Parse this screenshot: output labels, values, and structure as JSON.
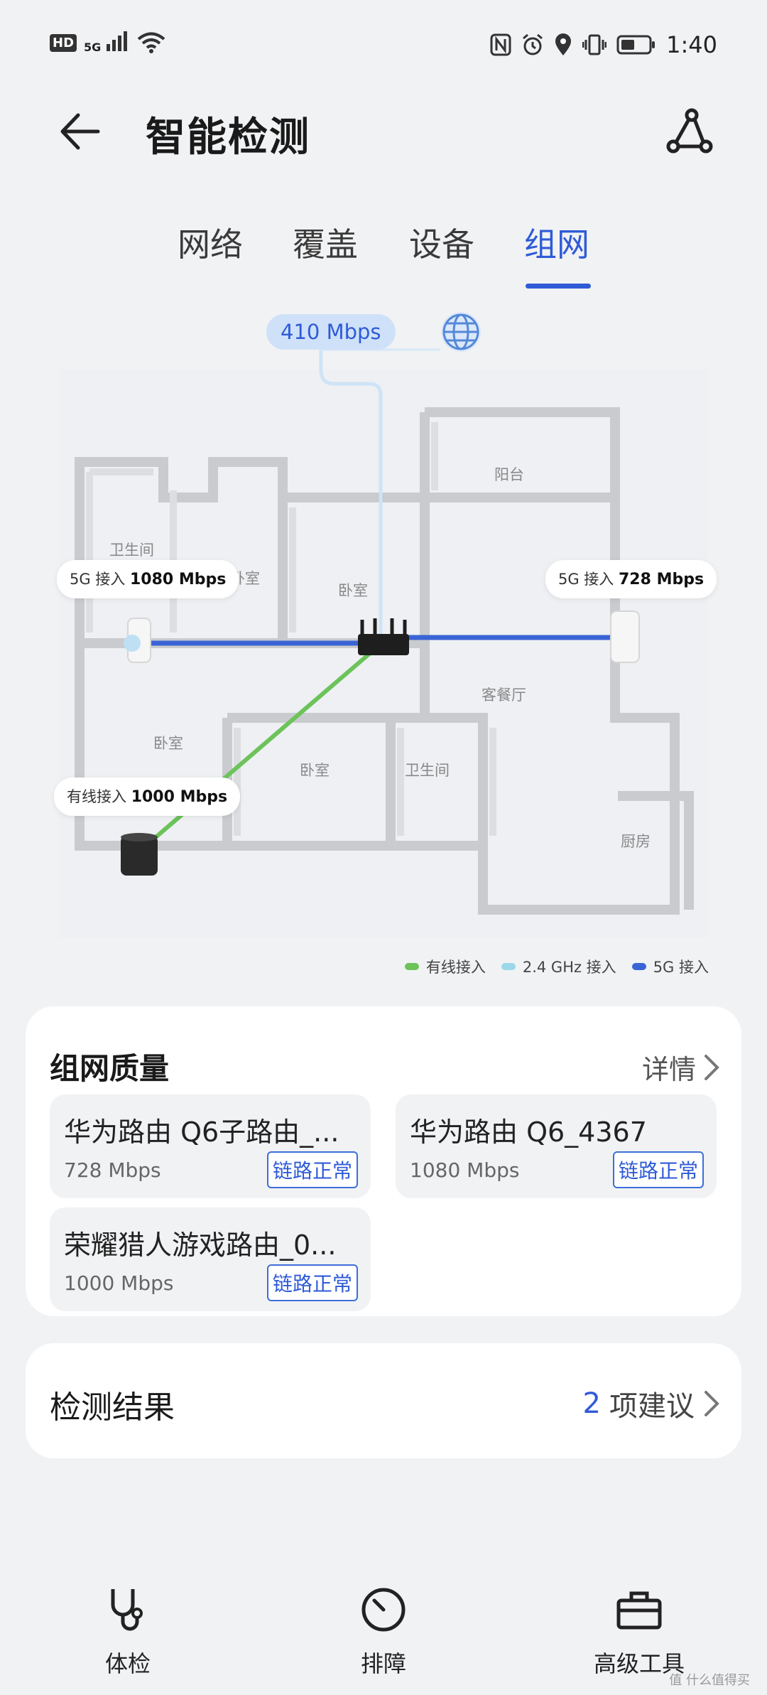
{
  "status_bar": {
    "left_icons": [
      "hd-icon",
      "signal-5g-icon",
      "wifi-icon"
    ],
    "hd": "HD",
    "net": "5G",
    "time": "1:40"
  },
  "header": {
    "title": "智能检测"
  },
  "tabs": [
    {
      "label": "网络"
    },
    {
      "label": "覆盖"
    },
    {
      "label": "设备"
    },
    {
      "label": "组网",
      "active": true
    }
  ],
  "map": {
    "internet_speed": "410 Mbps",
    "rooms": {
      "balcony": "阳台",
      "bath1": "卫生间",
      "bed_top_left": "卧室",
      "bed_center": "卧室",
      "living": "客餐厅",
      "bed_left": "卧室",
      "bed_bottom": "卧室",
      "bath2": "卫生间",
      "kitchen": "厨房"
    },
    "callouts": {
      "left": {
        "prefix": "5G 接入",
        "value": "1080 Mbps"
      },
      "right": {
        "prefix": "5G 接入",
        "value": "728 Mbps"
      },
      "wired": {
        "prefix": "有线接入",
        "value": "1000 Mbps"
      }
    },
    "legend": [
      {
        "label": "有线接入",
        "color": "#6cc35a"
      },
      {
        "label": "2.4 GHz 接入",
        "color": "#9ad8ea"
      },
      {
        "label": "5G 接入",
        "color": "#3a64d6"
      }
    ]
  },
  "quality": {
    "title": "组网质量",
    "detail": "详情",
    "nodes": [
      {
        "name": "华为路由 Q6子路由_...",
        "rate": "728 Mbps",
        "status": "链路正常"
      },
      {
        "name": "华为路由 Q6_4367",
        "rate": "1080 Mbps",
        "status": "链路正常"
      },
      {
        "name": "荣耀猎人游戏路由_0...",
        "rate": "1000 Mbps",
        "status": "链路正常"
      }
    ]
  },
  "result": {
    "title": "检测结果",
    "count": "2",
    "suffix": "项建议"
  },
  "bottom_nav": [
    {
      "label": "体检"
    },
    {
      "label": "排障"
    },
    {
      "label": "高级工具"
    }
  ],
  "watermark": "值 什么值得买"
}
